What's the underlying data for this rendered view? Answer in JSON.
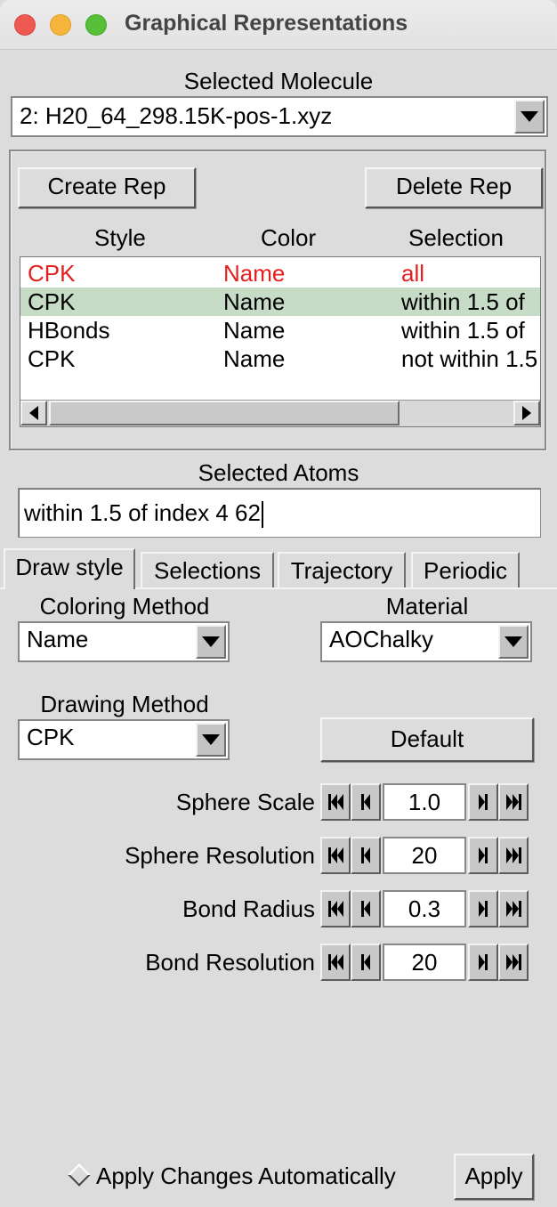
{
  "window": {
    "title": "Graphical Representations"
  },
  "molecule": {
    "label": "Selected Molecule",
    "value": "2: H20_64_298.15K-pos-1.xyz"
  },
  "reps": {
    "create_label": "Create Rep",
    "delete_label": "Delete Rep",
    "columns": [
      "Style",
      "Color",
      "Selection"
    ],
    "rows": [
      {
        "style": "CPK",
        "color": "Name",
        "selection": "all"
      },
      {
        "style": "CPK",
        "color": "Name",
        "selection": "within 1.5 of"
      },
      {
        "style": "HBonds",
        "color": "Name",
        "selection": "within 1.5 of"
      },
      {
        "style": "CPK",
        "color": "Name",
        "selection": "not within 1.5"
      }
    ]
  },
  "atoms": {
    "label": "Selected Atoms",
    "value": "within 1.5 of index 4 62"
  },
  "tabs": [
    "Draw style",
    "Selections",
    "Trajectory",
    "Periodic"
  ],
  "draw": {
    "coloring_label": "Coloring Method",
    "coloring_value": "Name",
    "material_label": "Material",
    "material_value": "AOChalky",
    "drawing_label": "Drawing Method",
    "drawing_value": "CPK",
    "default_label": "Default",
    "params": [
      {
        "label": "Sphere Scale",
        "value": "1.0"
      },
      {
        "label": "Sphere Resolution",
        "value": "20"
      },
      {
        "label": "Bond Radius",
        "value": "0.3"
      },
      {
        "label": "Bond Resolution",
        "value": "20"
      }
    ]
  },
  "footer": {
    "auto_label": "Apply Changes Automatically",
    "apply_label": "Apply"
  },
  "colors": {
    "selected_row_text": "#e32020",
    "highlight_row": "#c6dcc6"
  }
}
